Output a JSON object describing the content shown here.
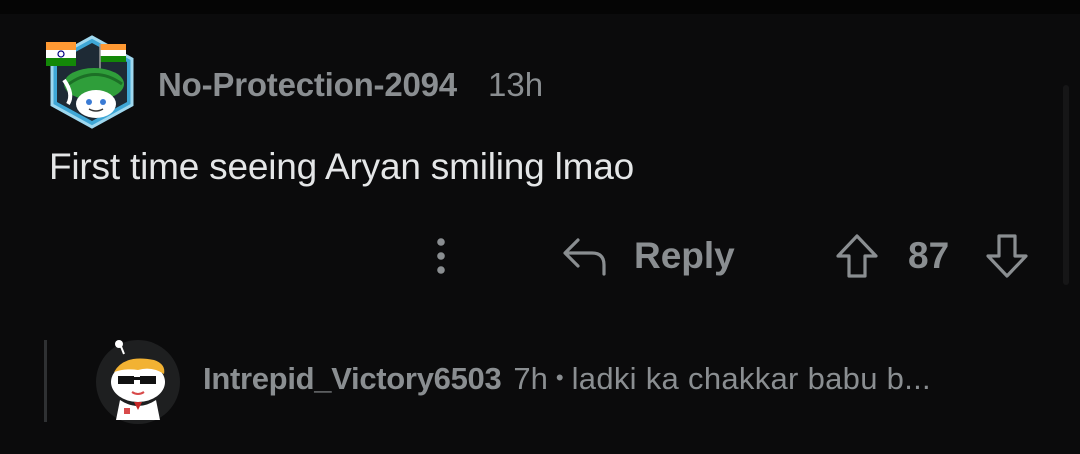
{
  "comment": {
    "username": "No-Protection-2094",
    "time": "13h",
    "body": "First time seeing Aryan smiling lmao",
    "actions": {
      "more_icon": "more-vertical-icon",
      "reply_icon": "reply-arrow-icon",
      "reply_label": "Reply",
      "upvote_icon": "arrow-up-icon",
      "vote_count": "87",
      "downvote_icon": "arrow-down-icon"
    }
  },
  "reply": {
    "username": "Intrepid_Victory6503",
    "time": "7h",
    "separator": "•",
    "snippet": "ladki ka chakkar babu b..."
  },
  "colors": {
    "background": "#0b0b0c",
    "text_primary": "#e4e6e7",
    "text_muted": "#8a8e91",
    "thread_line": "#2f3133"
  }
}
